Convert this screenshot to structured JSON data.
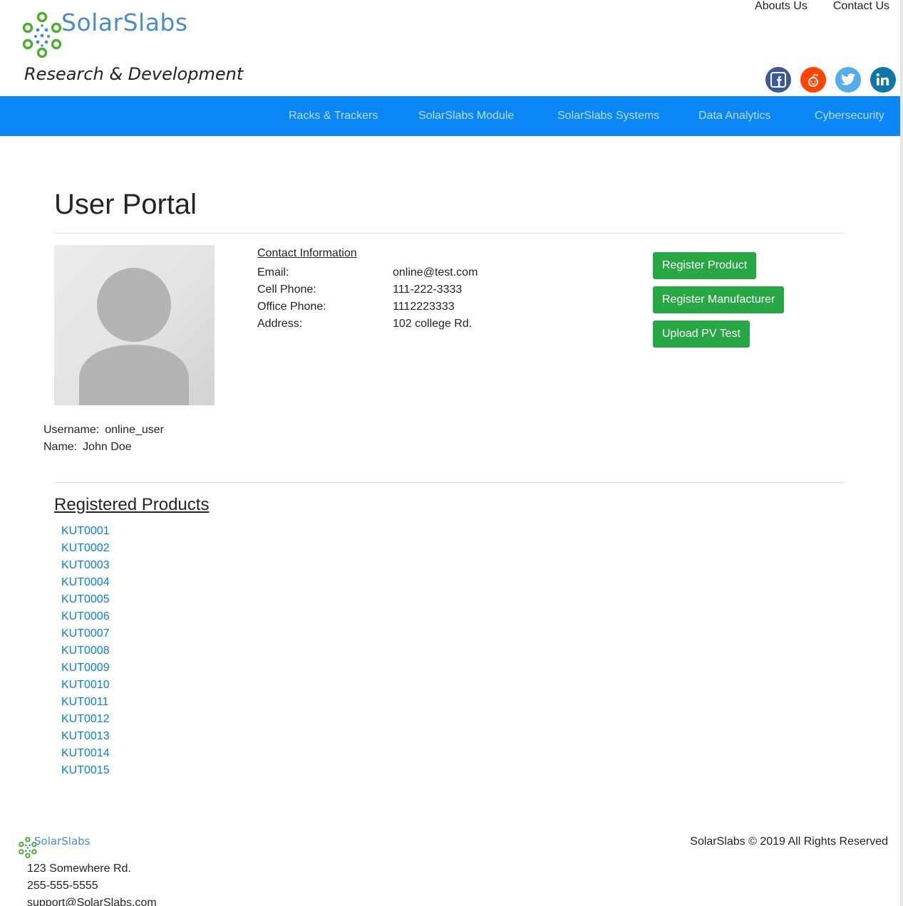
{
  "brand": {
    "name": "SolarSlabs",
    "tagline": "Research & Development"
  },
  "top_links": [
    "Abouts Us",
    "Contact Us"
  ],
  "social": {
    "facebook": "facebook-icon",
    "reddit": "reddit-icon",
    "twitter": "twitter-icon",
    "linkedin": "linkedin-icon"
  },
  "nav": [
    "Racks & Trackers",
    "SolarSlabs Module",
    "SolarSlabs Systems",
    "Data Analytics",
    "Cybersecurity"
  ],
  "page_title": "User Portal",
  "user": {
    "username_label": "Username:",
    "username": "online_user",
    "name_label": "Name:",
    "name": "John Doe"
  },
  "contact": {
    "heading": "Contact Information",
    "rows": [
      {
        "label": "Email:",
        "value": "online@test.com"
      },
      {
        "label": "Cell Phone:",
        "value": "111-222-3333"
      },
      {
        "label": "Office Phone:",
        "value": "1112223333"
      },
      {
        "label": "Address:",
        "value": "102 college Rd."
      }
    ]
  },
  "actions": {
    "register_product": "Register Product",
    "register_manufacturer": "Register Manufacturer",
    "upload_pv_test": "Upload PV Test"
  },
  "products": {
    "heading": "Registered Products",
    "items": [
      "KUT0001",
      "KUT0002",
      "KUT0003",
      "KUT0004",
      "KUT0005",
      "KUT0006",
      "KUT0007",
      "KUT0008",
      "KUT0009",
      "KUT0010",
      "KUT0011",
      "KUT0012",
      "KUT0013",
      "KUT0014",
      "KUT0015"
    ]
  },
  "footer": {
    "address": "123 Somewhere Rd.",
    "phone": "255-555-5555",
    "email": "support@SolarSlabs.com",
    "copyright": "SolarSlabs © 2019 All Rights Reserved"
  },
  "colors": {
    "nav_bg": "#0b86f5",
    "nav_text": "#b8dcfb",
    "button_green": "#28a745",
    "link_blue": "#0b7fe0",
    "logo_green": "#4caf32",
    "logo_blue": "#4a8cc9"
  }
}
